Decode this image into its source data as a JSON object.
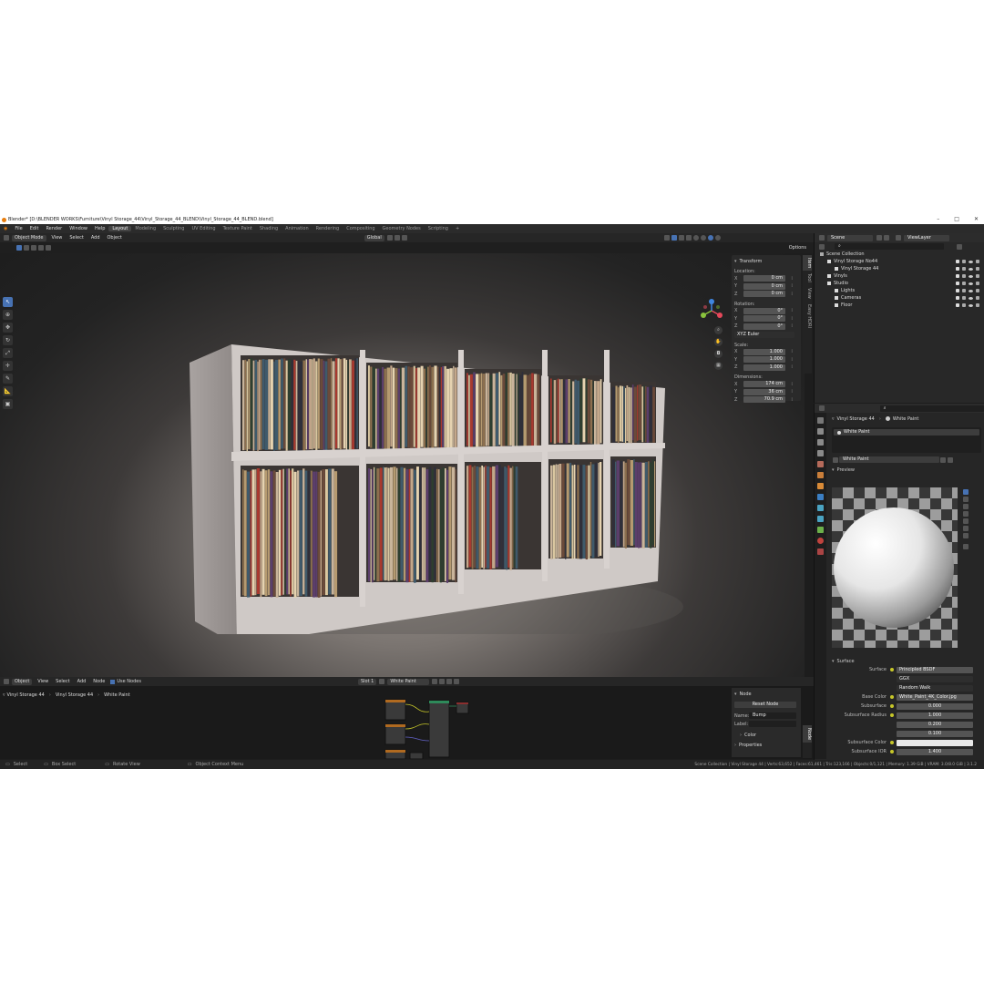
{
  "window": {
    "title": "Blender* [D:\\BLENDER WORKS\\Furniture\\Vinyl Storage_44\\Vinyl_Storage_44_BLEND\\Vinyl_Storage_44_BLEND.blend]"
  },
  "menu": [
    "File",
    "Edit",
    "Render",
    "Window",
    "Help"
  ],
  "workspaces": [
    "Layout",
    "Modeling",
    "Sculpting",
    "UV Editing",
    "Texture Paint",
    "Shading",
    "Animation",
    "Rendering",
    "Compositing",
    "Geometry Nodes",
    "Scripting"
  ],
  "viewport": {
    "mode": "Object Mode",
    "menus": [
      "View",
      "Select",
      "Add",
      "Object"
    ],
    "orientation": "Global",
    "options": "Options"
  },
  "npanel": {
    "transform": "Transform",
    "location_label": "Location:",
    "location": [
      [
        "X",
        "0 cm"
      ],
      [
        "Y",
        "0 cm"
      ],
      [
        "Z",
        "0 cm"
      ]
    ],
    "rotation_label": "Rotation:",
    "rotation": [
      [
        "X",
        "0°"
      ],
      [
        "Y",
        "0°"
      ],
      [
        "Z",
        "0°"
      ]
    ],
    "rotation_mode": "XYZ Euler",
    "scale_label": "Scale:",
    "scale": [
      [
        "X",
        "1.000"
      ],
      [
        "Y",
        "1.000"
      ],
      [
        "Z",
        "1.000"
      ]
    ],
    "dimensions_label": "Dimensions:",
    "dimensions": [
      [
        "X",
        "174 cm"
      ],
      [
        "Y",
        "36 cm"
      ],
      [
        "Z",
        "70.9 cm"
      ]
    ],
    "tabs": [
      "Item",
      "Tool",
      "View",
      "Easy HDRI"
    ]
  },
  "outliner": {
    "scene": "Scene",
    "viewlayer": "ViewLayer",
    "items": [
      {
        "name": "Scene Collection",
        "indent": 0
      },
      {
        "name": "Vinyl Storage No44",
        "indent": 1
      },
      {
        "name": "Vinyl Storage 44",
        "indent": 2
      },
      {
        "name": "Vinyls",
        "indent": 1
      },
      {
        "name": "Studio",
        "indent": 1
      },
      {
        "name": "Lights",
        "indent": 2
      },
      {
        "name": "Cameras",
        "indent": 2
      },
      {
        "name": "Floor",
        "indent": 2
      }
    ]
  },
  "properties": {
    "object": "Vinyl Storage 44",
    "material": "White Paint",
    "slot_material": "White Paint",
    "data_material": "White Paint",
    "preview_label": "Preview",
    "surface_section": "Surface",
    "fields": [
      {
        "k": "Surface",
        "v": "Principled BSDF",
        "dot": true
      },
      {
        "k": "",
        "v": "GGX",
        "dd": true
      },
      {
        "k": "",
        "v": "Random Walk",
        "dd": true
      },
      {
        "k": "Base Color",
        "v": "White_Paint_4K_Color.jpg",
        "dot": true
      },
      {
        "k": "Subsurface",
        "v": "0.000",
        "dot": true,
        "c": true
      },
      {
        "k": "Subsurface Radius",
        "v": "1.000",
        "dot": true,
        "c": true
      },
      {
        "k": "",
        "v": "0.200",
        "c": true
      },
      {
        "k": "",
        "v": "0.100",
        "c": true
      },
      {
        "k": "Subsurface Color",
        "v": "",
        "dot": true
      },
      {
        "k": "Subsurface IOR",
        "v": "1.400",
        "dot": true,
        "c": true
      }
    ]
  },
  "node_editor": {
    "mode": "Object",
    "menus": [
      "View",
      "Select",
      "Add",
      "Node"
    ],
    "use_nodes": "Use Nodes",
    "slot": "Slot 1",
    "material": "White Paint",
    "breadcrumb": [
      "Vinyl Storage 44",
      "Vinyl Storage 44",
      "White Paint"
    ],
    "panel_title": "Node",
    "reset": "Reset Node",
    "name_label": "Name:",
    "name_value": "Bump",
    "label_label": "Label:",
    "color": "Color",
    "properties": "Properties",
    "tab": "Node"
  },
  "status": {
    "items": [
      "Select",
      "Box Select",
      "Rotate View",
      "Object Context Menu"
    ],
    "right": "Scene Collection | Vinyl Storage 44 | Verts:63,652 | Faces:61,461 | Tris:123,166 | Objects:0/1,121 | Memory: 1.39 GiB | VRAM: 3.0/8.0 GiB | 3.1.2"
  },
  "colors": {
    "accent": "#4772b3",
    "bg": "#1d1d1d",
    "panel": "#2a2a2a"
  }
}
